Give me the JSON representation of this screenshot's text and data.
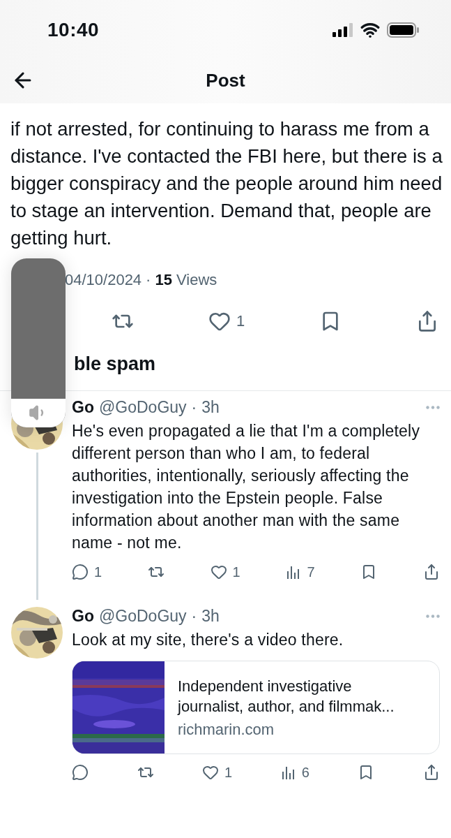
{
  "status_bar": {
    "time": "10:40"
  },
  "header": {
    "title": "Post"
  },
  "post": {
    "text": "if not arrested, for continuing to harass me from a distance. I've contacted the FBI here, but there is a bigger conspiracy and the people around him need to stage an intervention. Demand that, people are getting hurt.",
    "date": "04/10/2024",
    "separator": "·",
    "views_count": "15",
    "views_label": "Views",
    "actions": [
      {
        "kind": "retweet"
      },
      {
        "kind": "like",
        "count": "1"
      },
      {
        "kind": "bookmark"
      },
      {
        "kind": "share"
      }
    ]
  },
  "section_heading": "ble spam",
  "volume_hud": {
    "level": 0.17
  },
  "replies": [
    {
      "name": "Go",
      "handle": "@GoDoGuy",
      "separator": "·",
      "time": "3h",
      "thread_line": true,
      "text": "He's even propagated a lie that I'm a completely different person than who I am, to federal authorities, intentionally, seriously affecting the investigation into the Epstein people. False information about another man with the same name - not me.",
      "actions": [
        {
          "kind": "reply",
          "count": "1"
        },
        {
          "kind": "retweet"
        },
        {
          "kind": "like",
          "count": "1"
        },
        {
          "kind": "views",
          "count": "7"
        },
        {
          "kind": "bookmark"
        },
        {
          "kind": "share"
        }
      ]
    },
    {
      "name": "Go",
      "handle": "@GoDoGuy",
      "separator": "·",
      "time": "3h",
      "thread_line": false,
      "text": "Look at my site, there's a video there.",
      "link_card": {
        "title": "Independent investigative journalist, author, and filmmak...",
        "domain": "richmarin.com"
      },
      "actions": [
        {
          "kind": "reply"
        },
        {
          "kind": "retweet"
        },
        {
          "kind": "like",
          "count": "1"
        },
        {
          "kind": "views",
          "count": "6"
        },
        {
          "kind": "bookmark"
        },
        {
          "kind": "share"
        }
      ]
    }
  ]
}
